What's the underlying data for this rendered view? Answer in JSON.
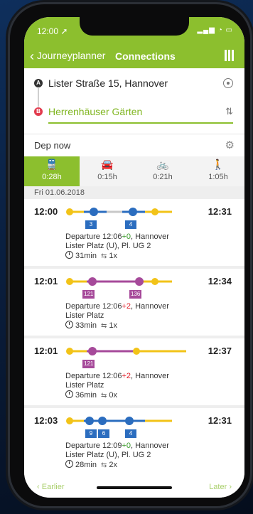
{
  "status": {
    "time": "12:00 ➚",
    "icons": "▂▄▆ ◔ ▭"
  },
  "nav": {
    "back_label": "Journeyplanner",
    "title": "Connections"
  },
  "search": {
    "from": "Lister Straße 15, Hannover",
    "to": "Herrenhäuser Gärten",
    "from_pin": "A",
    "to_pin": "B",
    "departure": "Dep now"
  },
  "modes": [
    {
      "icon": "bus-icon",
      "glyph": "🚆",
      "duration": "0:28h",
      "active": true
    },
    {
      "icon": "car-icon",
      "glyph": "🚘",
      "duration": "0:15h",
      "active": false
    },
    {
      "icon": "bike-icon",
      "glyph": "🚲",
      "duration": "0:21h",
      "active": false
    },
    {
      "icon": "walk-icon",
      "glyph": "🚶",
      "duration": "1:05h",
      "active": false
    }
  ],
  "date": "Fri 01.06.2018",
  "trips": [
    {
      "dep": "12:00",
      "arr": "12:31",
      "badges": [
        "3",
        "4"
      ],
      "departure_prefix": "Departure 12:06",
      "delay": "+0",
      "departure_suffix": ", Hannover",
      "stop": "Lister Platz (U), Pl. UG 2",
      "duration": "31min",
      "transfers": "1x"
    },
    {
      "dep": "12:01",
      "arr": "12:34",
      "badges": [
        "121",
        "136"
      ],
      "departure_prefix": "Departure 12:06",
      "delay": "+2",
      "departure_suffix": ", Hannover",
      "stop": "Lister Platz",
      "duration": "33min",
      "transfers": "1x"
    },
    {
      "dep": "12:01",
      "arr": "12:37",
      "badges": [
        "121"
      ],
      "departure_prefix": "Departure 12:06",
      "delay": "+2",
      "departure_suffix": ", Hannover",
      "stop": "Lister Platz",
      "duration": "36min",
      "transfers": "0x"
    },
    {
      "dep": "12:03",
      "arr": "12:31",
      "badges": [
        "9",
        "6",
        "4"
      ],
      "departure_prefix": "Departure 12:09",
      "delay": "+0",
      "departure_suffix": ", Hannover",
      "stop": "Lister Platz (U), Pl. UG 2",
      "duration": "28min",
      "transfers": "2x"
    }
  ],
  "pager": {
    "earlier": "Earlier",
    "later": "Later"
  },
  "colors": {
    "brand": "#8cbf2e",
    "ubahn": "#2b6dbf",
    "bus": "#a64a9a",
    "walk": "#f2c318",
    "late": "#e0202a",
    "ontime": "#3a9a2a"
  }
}
